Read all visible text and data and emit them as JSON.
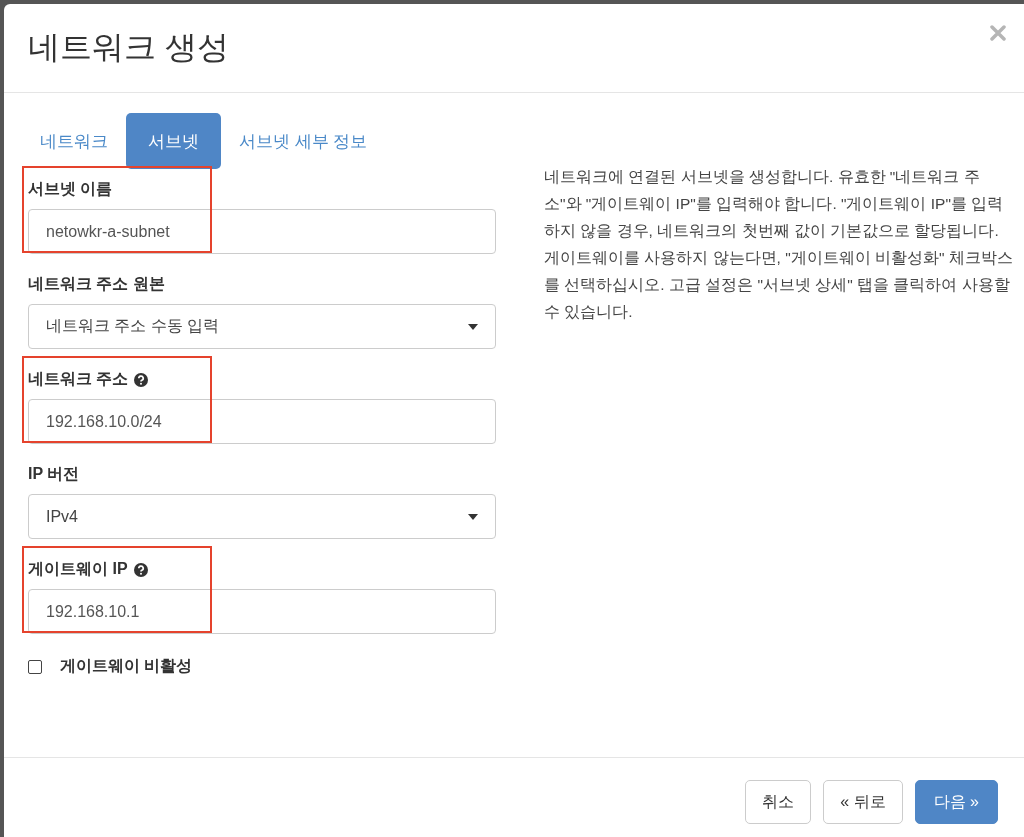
{
  "dialog": {
    "title": "네트워크 생성"
  },
  "tabs": [
    {
      "label": "네트워크",
      "selected": false
    },
    {
      "label": "서브넷",
      "selected": true
    },
    {
      "label": "서브넷 세부 정보",
      "selected": false
    }
  ],
  "fields": [
    {
      "kind": "text",
      "label": "서브넷 이름",
      "value": "netowkr-a-subnet",
      "help": false,
      "highlighted": true
    },
    {
      "kind": "select",
      "label": "네트워크 주소 원본",
      "value": "네트워크 주소 수동 입력",
      "help": false,
      "highlighted": false
    },
    {
      "kind": "text",
      "label": "네트워크 주소",
      "value": "192.168.10.0/24",
      "help": true,
      "highlighted": true
    },
    {
      "kind": "select",
      "label": "IP 버전",
      "value": "IPv4",
      "help": false,
      "highlighted": false
    },
    {
      "kind": "text",
      "label": "게이트웨이 IP",
      "value": "192.168.10.1",
      "help": true,
      "highlighted": true
    },
    {
      "kind": "checkbox",
      "label": "게이트웨이 비활성",
      "checked": false,
      "highlighted": false
    }
  ],
  "description": "네트워크에 연결된 서브넷을 생성합니다. 유효한 \"네트워크 주소\"와 \"게이트웨이 IP\"를 입력해야 합니다. \"게이트웨이 IP\"를 입력하지 않을 경우, 네트워크의 첫번째 값이 기본값으로 할당됩니다. 게이트웨이를 사용하지 않는다면, \"게이트웨이 비활성화\" 체크박스를 선택하십시오. 고급 설정은 \"서브넷 상세\" 탭을 클릭하여 사용할 수 있습니다.",
  "buttons": [
    {
      "label": "취소",
      "kind": "default"
    },
    {
      "label": "« 뒤로",
      "kind": "default"
    },
    {
      "label": "다음 »",
      "kind": "primary"
    }
  ]
}
